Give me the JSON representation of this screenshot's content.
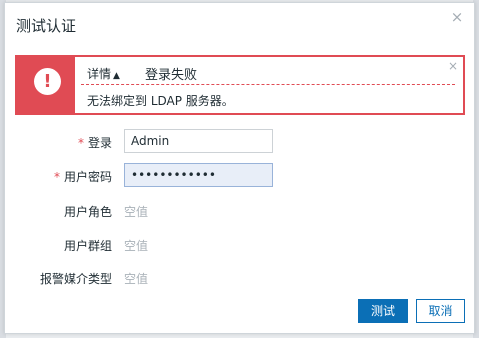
{
  "dialog": {
    "title": "测试认证",
    "close_symbol": "×"
  },
  "error": {
    "details_label": "详情",
    "details_arrow": "▲",
    "title": "登录失败",
    "message": "无法绑定到 LDAP 服务器。",
    "icon_symbol": "!",
    "close_symbol": "×",
    "color": "#e04b54"
  },
  "form": {
    "login": {
      "required_mark": "*",
      "label": "登录",
      "value": "Admin"
    },
    "password": {
      "required_mark": "*",
      "label": "用户密码",
      "value": "••••••••••••"
    },
    "user_role": {
      "label": "用户角色",
      "value": "空值"
    },
    "user_groups": {
      "label": "用户群组",
      "value": "空值"
    },
    "media_types": {
      "label": "报警媒介类型",
      "value": "空值"
    }
  },
  "buttons": {
    "test": "测试",
    "cancel": "取消"
  },
  "colors": {
    "accent": "#0b6fb6",
    "error": "#e04b54"
  }
}
